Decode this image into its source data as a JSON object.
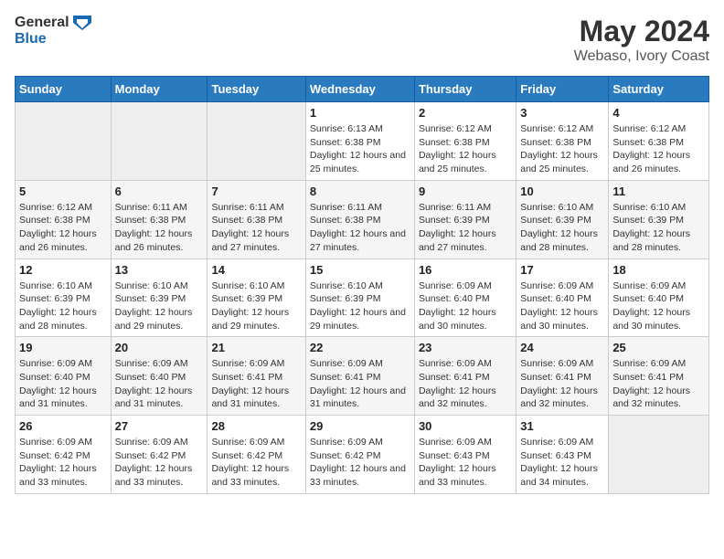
{
  "logo": {
    "text_general": "General",
    "text_blue": "Blue"
  },
  "header": {
    "title": "May 2024",
    "subtitle": "Webaso, Ivory Coast"
  },
  "weekdays": [
    "Sunday",
    "Monday",
    "Tuesday",
    "Wednesday",
    "Thursday",
    "Friday",
    "Saturday"
  ],
  "weeks": [
    [
      {
        "day": "",
        "sunrise": "",
        "sunset": "",
        "daylight": "",
        "empty": true
      },
      {
        "day": "",
        "sunrise": "",
        "sunset": "",
        "daylight": "",
        "empty": true
      },
      {
        "day": "",
        "sunrise": "",
        "sunset": "",
        "daylight": "",
        "empty": true
      },
      {
        "day": "1",
        "sunrise": "Sunrise: 6:13 AM",
        "sunset": "Sunset: 6:38 PM",
        "daylight": "Daylight: 12 hours and 25 minutes.",
        "empty": false
      },
      {
        "day": "2",
        "sunrise": "Sunrise: 6:12 AM",
        "sunset": "Sunset: 6:38 PM",
        "daylight": "Daylight: 12 hours and 25 minutes.",
        "empty": false
      },
      {
        "day": "3",
        "sunrise": "Sunrise: 6:12 AM",
        "sunset": "Sunset: 6:38 PM",
        "daylight": "Daylight: 12 hours and 25 minutes.",
        "empty": false
      },
      {
        "day": "4",
        "sunrise": "Sunrise: 6:12 AM",
        "sunset": "Sunset: 6:38 PM",
        "daylight": "Daylight: 12 hours and 26 minutes.",
        "empty": false
      }
    ],
    [
      {
        "day": "5",
        "sunrise": "Sunrise: 6:12 AM",
        "sunset": "Sunset: 6:38 PM",
        "daylight": "Daylight: 12 hours and 26 minutes.",
        "empty": false
      },
      {
        "day": "6",
        "sunrise": "Sunrise: 6:11 AM",
        "sunset": "Sunset: 6:38 PM",
        "daylight": "Daylight: 12 hours and 26 minutes.",
        "empty": false
      },
      {
        "day": "7",
        "sunrise": "Sunrise: 6:11 AM",
        "sunset": "Sunset: 6:38 PM",
        "daylight": "Daylight: 12 hours and 27 minutes.",
        "empty": false
      },
      {
        "day": "8",
        "sunrise": "Sunrise: 6:11 AM",
        "sunset": "Sunset: 6:38 PM",
        "daylight": "Daylight: 12 hours and 27 minutes.",
        "empty": false
      },
      {
        "day": "9",
        "sunrise": "Sunrise: 6:11 AM",
        "sunset": "Sunset: 6:39 PM",
        "daylight": "Daylight: 12 hours and 27 minutes.",
        "empty": false
      },
      {
        "day": "10",
        "sunrise": "Sunrise: 6:10 AM",
        "sunset": "Sunset: 6:39 PM",
        "daylight": "Daylight: 12 hours and 28 minutes.",
        "empty": false
      },
      {
        "day": "11",
        "sunrise": "Sunrise: 6:10 AM",
        "sunset": "Sunset: 6:39 PM",
        "daylight": "Daylight: 12 hours and 28 minutes.",
        "empty": false
      }
    ],
    [
      {
        "day": "12",
        "sunrise": "Sunrise: 6:10 AM",
        "sunset": "Sunset: 6:39 PM",
        "daylight": "Daylight: 12 hours and 28 minutes.",
        "empty": false
      },
      {
        "day": "13",
        "sunrise": "Sunrise: 6:10 AM",
        "sunset": "Sunset: 6:39 PM",
        "daylight": "Daylight: 12 hours and 29 minutes.",
        "empty": false
      },
      {
        "day": "14",
        "sunrise": "Sunrise: 6:10 AM",
        "sunset": "Sunset: 6:39 PM",
        "daylight": "Daylight: 12 hours and 29 minutes.",
        "empty": false
      },
      {
        "day": "15",
        "sunrise": "Sunrise: 6:10 AM",
        "sunset": "Sunset: 6:39 PM",
        "daylight": "Daylight: 12 hours and 29 minutes.",
        "empty": false
      },
      {
        "day": "16",
        "sunrise": "Sunrise: 6:09 AM",
        "sunset": "Sunset: 6:40 PM",
        "daylight": "Daylight: 12 hours and 30 minutes.",
        "empty": false
      },
      {
        "day": "17",
        "sunrise": "Sunrise: 6:09 AM",
        "sunset": "Sunset: 6:40 PM",
        "daylight": "Daylight: 12 hours and 30 minutes.",
        "empty": false
      },
      {
        "day": "18",
        "sunrise": "Sunrise: 6:09 AM",
        "sunset": "Sunset: 6:40 PM",
        "daylight": "Daylight: 12 hours and 30 minutes.",
        "empty": false
      }
    ],
    [
      {
        "day": "19",
        "sunrise": "Sunrise: 6:09 AM",
        "sunset": "Sunset: 6:40 PM",
        "daylight": "Daylight: 12 hours and 31 minutes.",
        "empty": false
      },
      {
        "day": "20",
        "sunrise": "Sunrise: 6:09 AM",
        "sunset": "Sunset: 6:40 PM",
        "daylight": "Daylight: 12 hours and 31 minutes.",
        "empty": false
      },
      {
        "day": "21",
        "sunrise": "Sunrise: 6:09 AM",
        "sunset": "Sunset: 6:41 PM",
        "daylight": "Daylight: 12 hours and 31 minutes.",
        "empty": false
      },
      {
        "day": "22",
        "sunrise": "Sunrise: 6:09 AM",
        "sunset": "Sunset: 6:41 PM",
        "daylight": "Daylight: 12 hours and 31 minutes.",
        "empty": false
      },
      {
        "day": "23",
        "sunrise": "Sunrise: 6:09 AM",
        "sunset": "Sunset: 6:41 PM",
        "daylight": "Daylight: 12 hours and 32 minutes.",
        "empty": false
      },
      {
        "day": "24",
        "sunrise": "Sunrise: 6:09 AM",
        "sunset": "Sunset: 6:41 PM",
        "daylight": "Daylight: 12 hours and 32 minutes.",
        "empty": false
      },
      {
        "day": "25",
        "sunrise": "Sunrise: 6:09 AM",
        "sunset": "Sunset: 6:41 PM",
        "daylight": "Daylight: 12 hours and 32 minutes.",
        "empty": false
      }
    ],
    [
      {
        "day": "26",
        "sunrise": "Sunrise: 6:09 AM",
        "sunset": "Sunset: 6:42 PM",
        "daylight": "Daylight: 12 hours and 33 minutes.",
        "empty": false
      },
      {
        "day": "27",
        "sunrise": "Sunrise: 6:09 AM",
        "sunset": "Sunset: 6:42 PM",
        "daylight": "Daylight: 12 hours and 33 minutes.",
        "empty": false
      },
      {
        "day": "28",
        "sunrise": "Sunrise: 6:09 AM",
        "sunset": "Sunset: 6:42 PM",
        "daylight": "Daylight: 12 hours and 33 minutes.",
        "empty": false
      },
      {
        "day": "29",
        "sunrise": "Sunrise: 6:09 AM",
        "sunset": "Sunset: 6:42 PM",
        "daylight": "Daylight: 12 hours and 33 minutes.",
        "empty": false
      },
      {
        "day": "30",
        "sunrise": "Sunrise: 6:09 AM",
        "sunset": "Sunset: 6:43 PM",
        "daylight": "Daylight: 12 hours and 33 minutes.",
        "empty": false
      },
      {
        "day": "31",
        "sunrise": "Sunrise: 6:09 AM",
        "sunset": "Sunset: 6:43 PM",
        "daylight": "Daylight: 12 hours and 34 minutes.",
        "empty": false
      },
      {
        "day": "",
        "sunrise": "",
        "sunset": "",
        "daylight": "",
        "empty": true
      }
    ]
  ]
}
